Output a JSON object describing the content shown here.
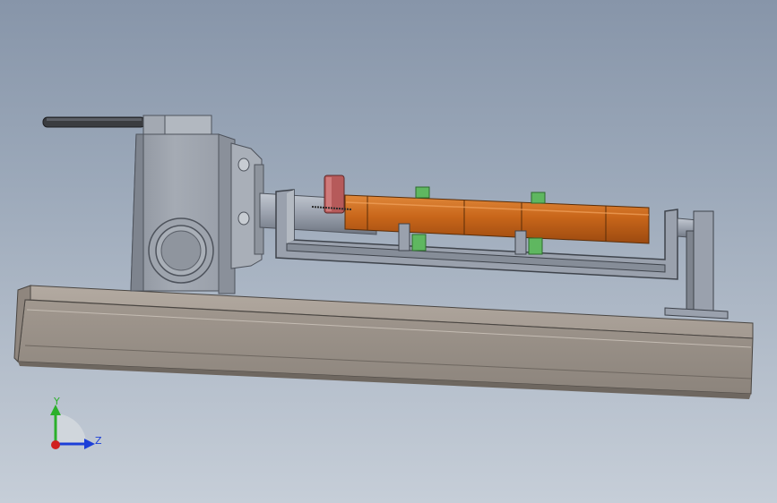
{
  "viewport": {
    "background_top": "#8795a9",
    "background_bottom": "#c6ced8"
  },
  "model": {
    "colors": {
      "steel": "#9aa1ad",
      "steel_dark": "#6f7682",
      "base_top": "#a89f96",
      "base_front": "#978e86",
      "tube": "#c8661a",
      "tube_highlight": "#e0883a",
      "green_block": "#5fb760",
      "red_part": "#b65a5a",
      "handle": "#3a3c40"
    }
  },
  "triad": {
    "y_label": "Y",
    "z_label": "Z",
    "y_color": "#2bb02b",
    "z_color": "#1c3fd8",
    "x_color": "#d02020"
  }
}
